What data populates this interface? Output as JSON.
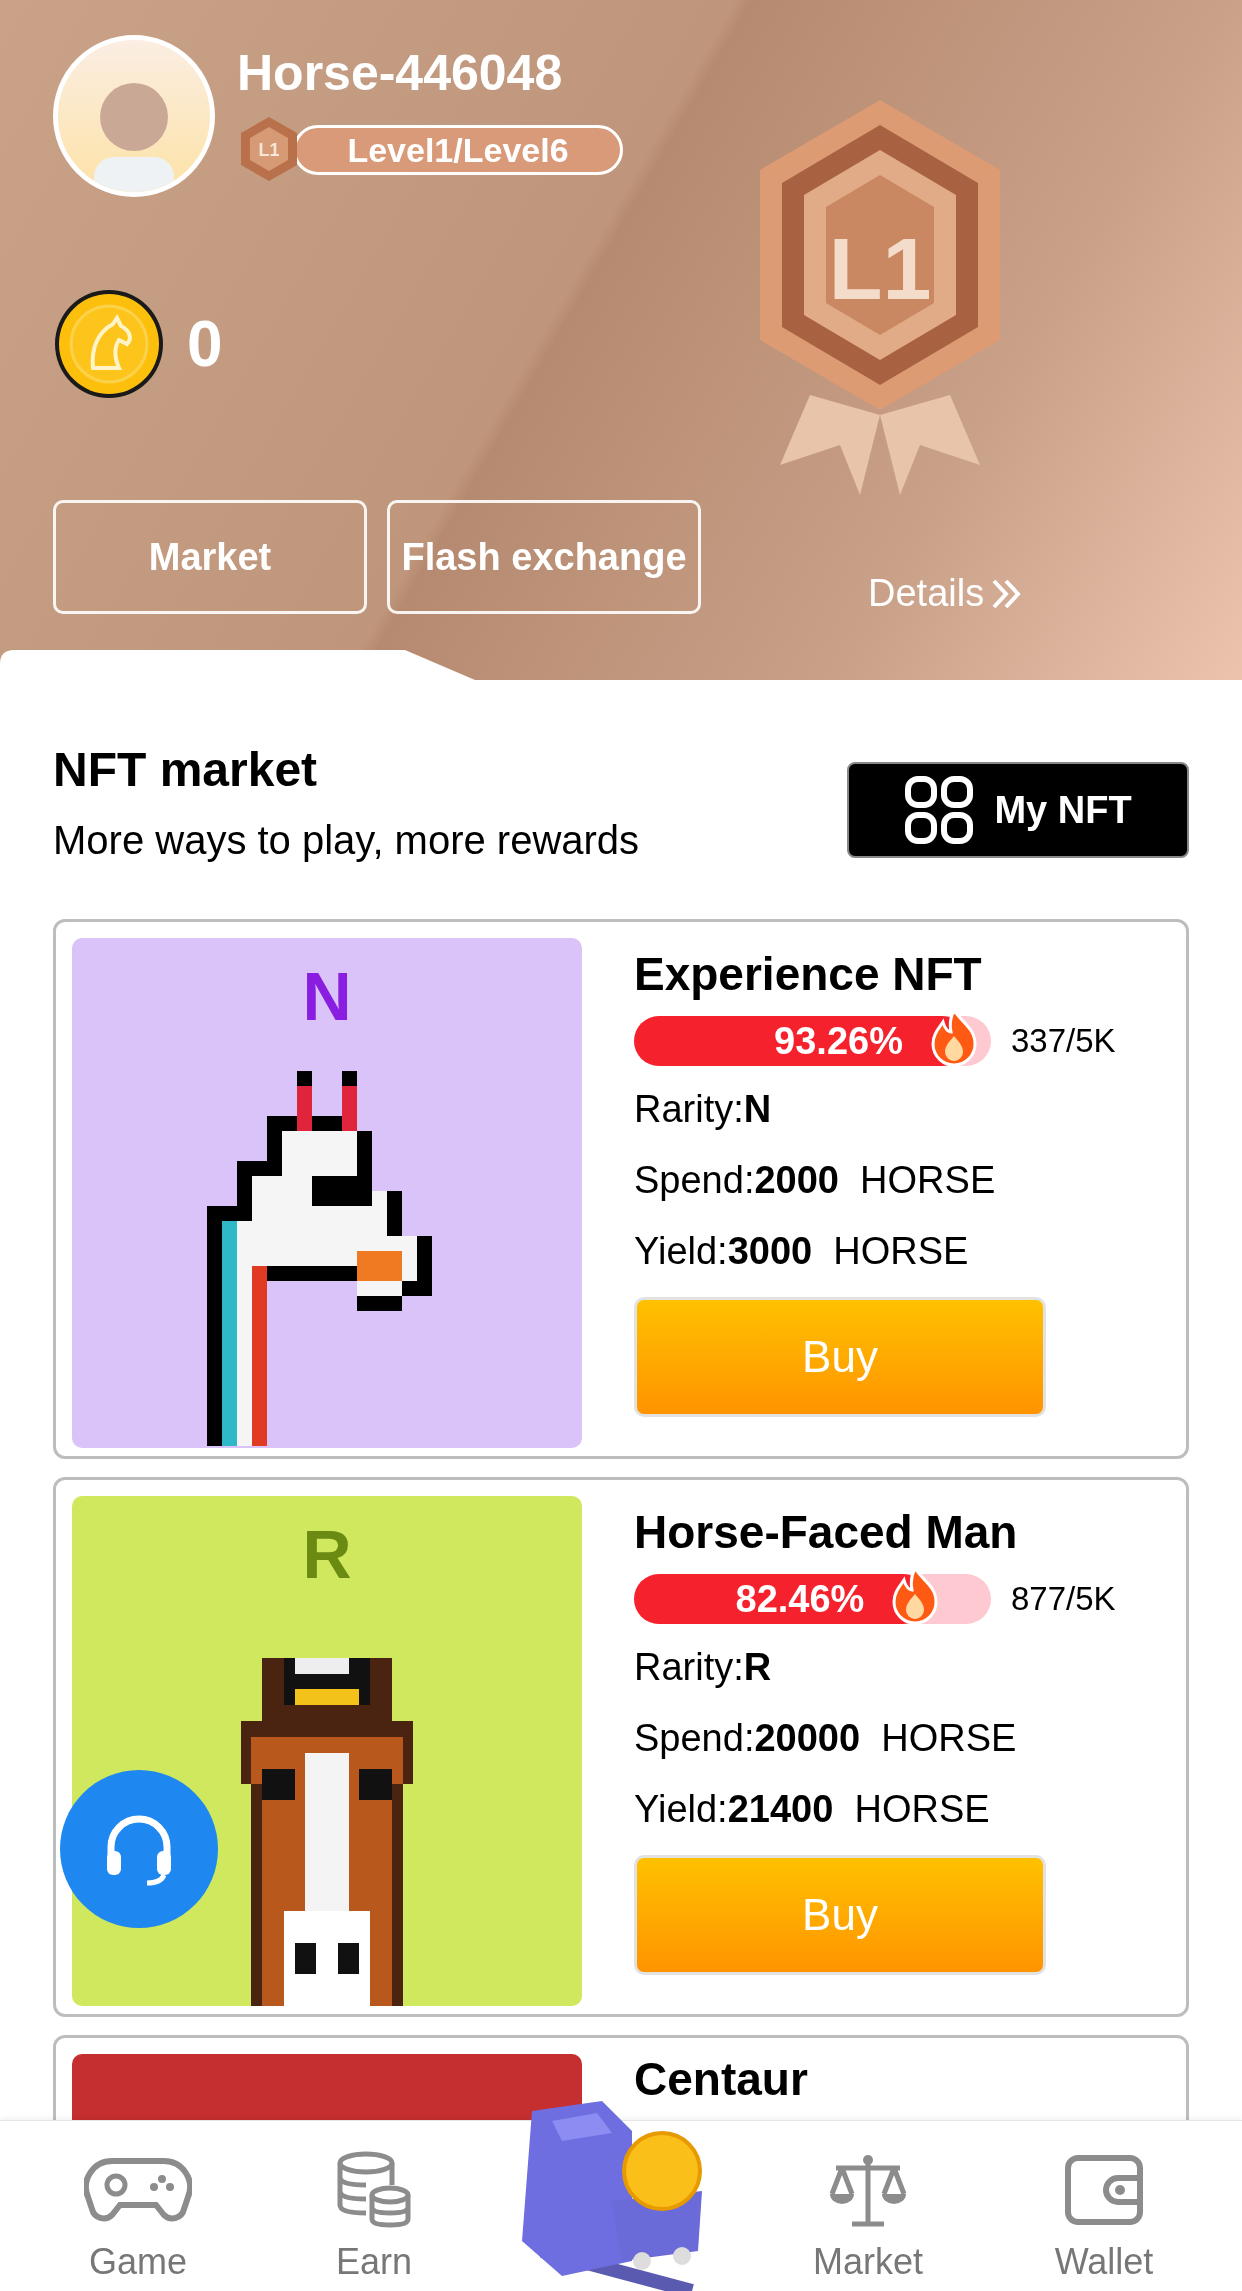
{
  "profile": {
    "username": "Horse-446048",
    "level_badge_label": "L1",
    "level_text": "Level1/Level6",
    "balance": "0"
  },
  "header_buttons": [
    "Market",
    "Flash exchange"
  ],
  "medal": {
    "label": "L1",
    "details_link": "Details"
  },
  "section": {
    "title": "NFT market",
    "subtitle": "More ways to play, more rewards",
    "my_nft_button": "My NFT"
  },
  "nfts": [
    {
      "rarity_letter": "N",
      "color": "#d9c3f8",
      "name": "Experience NFT",
      "progress_text": "93.26%",
      "level": 0.9326,
      "count": "337/5K",
      "rarity": "Rarity:**N**",
      "spend": "Spend:**2000**  HORSE",
      "yield": "Yield:**3000**  HORSE",
      "buy": "Buy"
    },
    {
      "rarity_letter": "R",
      "color": "#d0e85e",
      "name": "Horse-Faced Man",
      "progress_text": "82.46%",
      "level": 0.8246,
      "count": "877/5K",
      "rarity": "Rarity:**R**",
      "spend": "Spend:**20000**  HORSE",
      "yield": "Yield:**21400**  HORSE",
      "buy": "Buy"
    },
    {
      "color": "#c62f30",
      "name": "Centaur"
    }
  ],
  "bottom_nav": [
    {
      "label": "Game"
    },
    {
      "label": "Earn"
    },
    {
      "label": "Market"
    },
    {
      "label": "Wallet"
    }
  ]
}
